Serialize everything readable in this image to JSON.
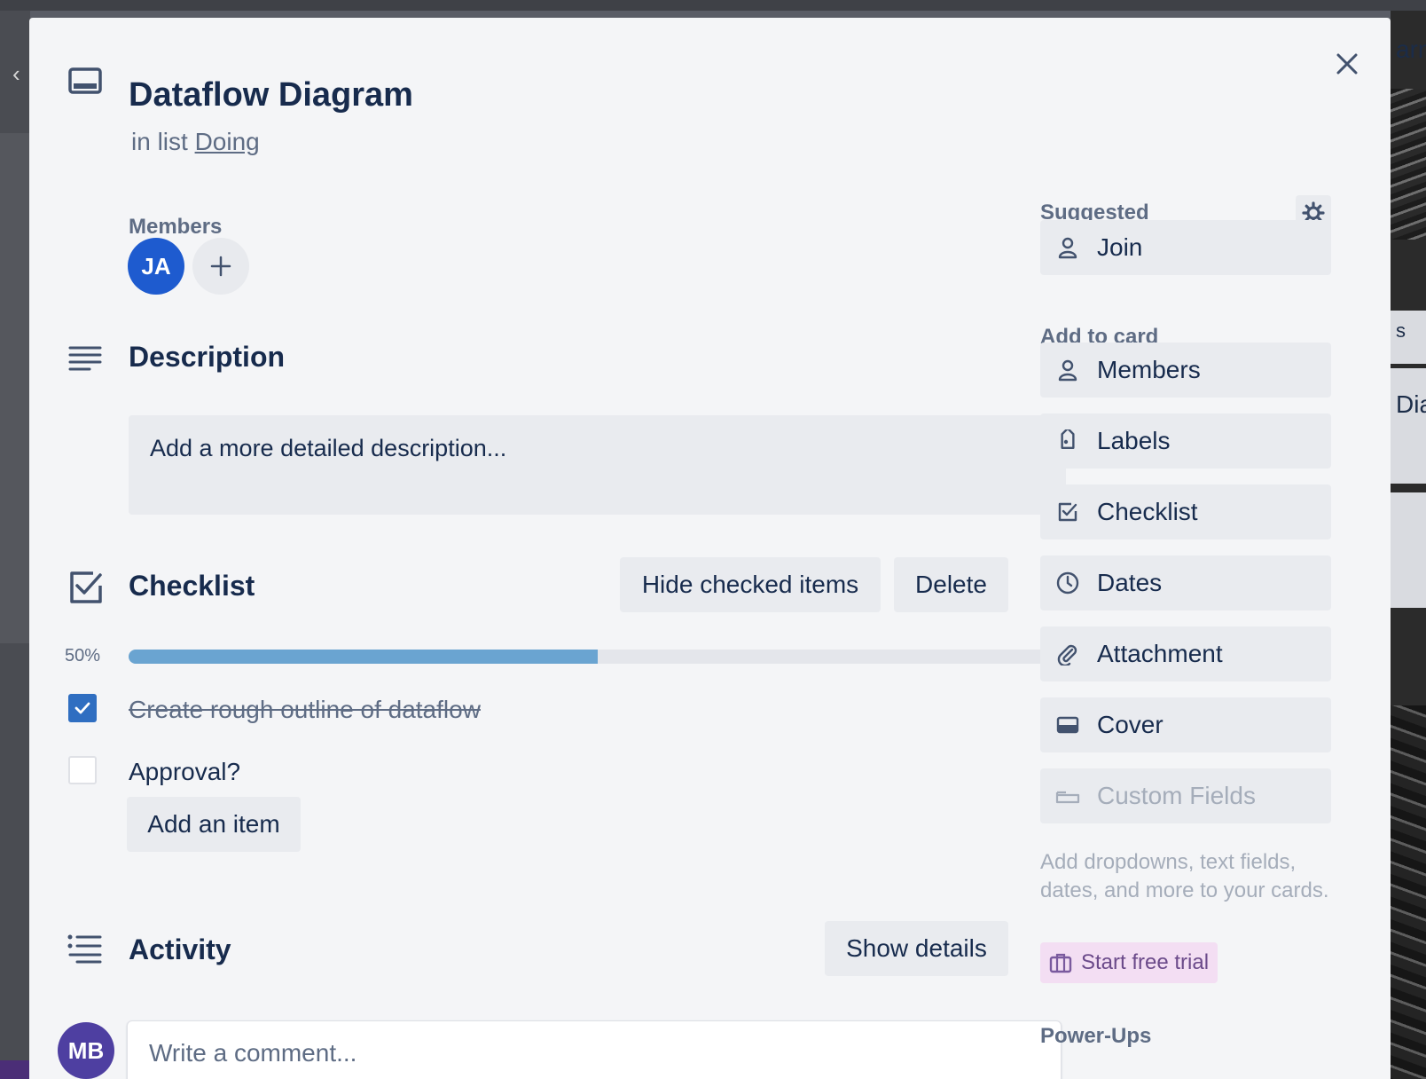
{
  "background": {
    "right_fragment_top": "arn",
    "right_fragment_mid": "s",
    "right_fragment_card": "Dia"
  },
  "card": {
    "title": "Dataflow Diagram",
    "in_list_prefix": "in list",
    "list_name": "Doing",
    "card_icon": "card-icon",
    "close_icon": "close-icon"
  },
  "members": {
    "label": "Members",
    "avatar_initials": "JA",
    "avatar_color": "#1e5bcf",
    "add_icon": "plus-icon"
  },
  "description": {
    "title": "Description",
    "placeholder": "Add a more detailed description..."
  },
  "checklist": {
    "title": "Checklist",
    "hide_checked_label": "Hide checked items",
    "delete_label": "Delete",
    "progress_label": "50%",
    "progress_fraction": 0.5,
    "items": [
      {
        "text": "Create rough outline of dataflow",
        "checked": true
      },
      {
        "text": "Approval?",
        "checked": false
      }
    ],
    "add_item_label": "Add an item"
  },
  "activity": {
    "title": "Activity",
    "show_details_label": "Show details",
    "comment_placeholder": "Write a comment...",
    "user_initials": "MB",
    "user_color": "#4e3fa1"
  },
  "sidebar": {
    "suggested_label": "Suggested",
    "join_label": "Join",
    "add_to_card_label": "Add to card",
    "buttons": [
      {
        "label": "Members",
        "icon": "person-icon"
      },
      {
        "label": "Labels",
        "icon": "tag-icon"
      },
      {
        "label": "Checklist",
        "icon": "checkbox-icon"
      },
      {
        "label": "Dates",
        "icon": "clock-icon"
      },
      {
        "label": "Attachment",
        "icon": "paperclip-icon"
      },
      {
        "label": "Cover",
        "icon": "cover-icon"
      },
      {
        "label": "Custom Fields",
        "icon": "custom-fields-icon"
      }
    ],
    "custom_fields_note": "Add dropdowns, text fields, dates, and more to your cards.",
    "start_trial_label": "Start free trial",
    "power_ups_label": "Power-Ups"
  },
  "colors": {
    "accent": "#2f6ec1",
    "progress_fill": "#6aa4d1",
    "trial_bg": "#f3def3"
  }
}
